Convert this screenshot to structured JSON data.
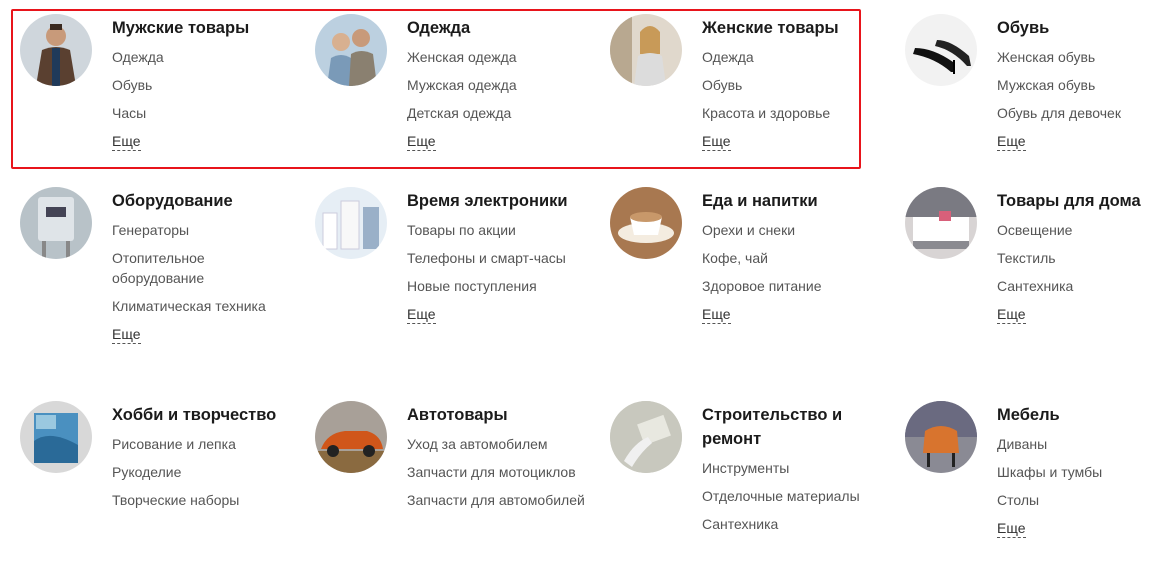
{
  "categories": [
    {
      "title": "Мужские товары",
      "items": [
        "Одежда",
        "Обувь",
        "Часы"
      ],
      "more": "Еще",
      "image": "man-in-coat-photo"
    },
    {
      "title": "Одежда",
      "items": [
        "Женская одежда",
        "Мужская одежда",
        "Детская одежда"
      ],
      "more": "Еще",
      "image": "couple-photo"
    },
    {
      "title": "Женские товары",
      "items": [
        "Одежда",
        "Обувь",
        "Красота и здоровье"
      ],
      "more": "Еще",
      "image": "woman-photo"
    },
    {
      "title": "Обувь",
      "items": [
        "Женская обувь",
        "Мужская обувь",
        "Обувь для девочек"
      ],
      "more": "Еще",
      "image": "high-heels-photo"
    },
    {
      "title": "Оборудование",
      "items": [
        "Генераторы",
        "Отопительное оборудование",
        "Климатическая техника"
      ],
      "more": "Еще",
      "image": "boiler-photo"
    },
    {
      "title": "Время электроники",
      "items": [
        "Товары по акции",
        "Телефоны и смарт-часы",
        "Новые поступления"
      ],
      "more": "Еще",
      "image": "electronics-photo"
    },
    {
      "title": "Еда и напитки",
      "items": [
        "Орехи и снеки",
        "Кофе, чай",
        "Здоровое питание"
      ],
      "more": "Еще",
      "image": "coffee-cup-photo"
    },
    {
      "title": "Товары для дома",
      "items": [
        "Освещение",
        "Текстиль",
        "Сантехника"
      ],
      "more": "Еще",
      "image": "bedroom-photo"
    },
    {
      "title": "Хобби и творчество",
      "items": [
        "Рисование и лепка",
        "Рукоделие",
        "Творческие наборы"
      ],
      "more": null,
      "image": "canvas-painting-photo"
    },
    {
      "title": "Автотовары",
      "items": [
        "Уход за автомобилем",
        "Запчасти для мотоциклов",
        "Запчасти для автомобилей"
      ],
      "more": null,
      "image": "orange-car-photo"
    },
    {
      "title": "Строительство и ремонт",
      "items": [
        "Инструменты",
        "Отделочные материалы",
        "Сантехника"
      ],
      "more": null,
      "image": "plastering-photo"
    },
    {
      "title": "Мебель",
      "items": [
        "Диваны",
        "Шкафы и тумбы",
        "Столы"
      ],
      "more": "Еще",
      "image": "armchair-photo"
    }
  ],
  "highlight_color": "#e8141b"
}
